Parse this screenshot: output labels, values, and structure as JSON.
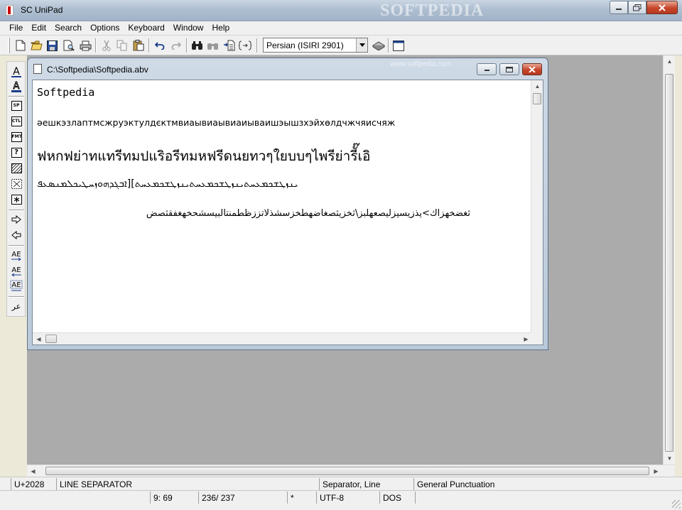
{
  "window": {
    "title": "SC UniPad",
    "watermark": "SOFTPEDIA"
  },
  "menu": [
    "File",
    "Edit",
    "Search",
    "Options",
    "Keyboard",
    "Window",
    "Help"
  ],
  "toolbar": {
    "keyboard_layout": "Persian (ISIRI 2901)",
    "icons": [
      "new-file-icon",
      "open-folder-icon",
      "save-icon",
      "print-preview-icon",
      "print-icon",
      "cut-icon",
      "copy-icon",
      "paste-icon",
      "undo-icon",
      "redo-icon",
      "find-icon",
      "find-next-icon",
      "replace-icon",
      "goto-icon",
      "keyboard-icon",
      "window-icon"
    ]
  },
  "vtoolbar": {
    "labels": {
      "sp": "SP",
      "ctl": "CTL",
      "fmt": "FMT",
      "q": "?",
      "ae": "AE",
      "ar": "عر"
    }
  },
  "document": {
    "title": "C:\\Softpedia\\Softpedia.abv",
    "watermark": "www.softpedia.com",
    "lines": [
      "Softpedia",
      "әешкэзлаптмсжруэктулдєктмвиаывиаывиаиываишэышзхэйхөлдчжчяисчяж",
      "ฟหกฟย่าทแทรีทมปแริอรีทมหฟรีดนยทวๆใยบบๆไพรีย่ารีั๊เอิ",
      "ܝܢܙܛܫܟܡܥܚܬܝܢܙܛܫܟܡܥܚܬܝܢܙܛܫܟܡܥܚܬ][ܐܒܓܕܗܘܙܚܛܝܟܠܡܢܣܥܦ",
      "ثغضخهزاك>يذزيسيزليصعهلبز\\ثخزيثصغاضهطخزسشذلاتززظطمنتالبيسشحخهغفقثصض"
    ]
  },
  "status": {
    "code": "U+2028",
    "char_name": "LINE SEPARATOR",
    "category": "Separator, Line",
    "block": "General Punctuation",
    "position": "9: 69",
    "lines": "236/ 237",
    "modified": "*",
    "encoding": "UTF-8",
    "eol": "DOS"
  }
}
